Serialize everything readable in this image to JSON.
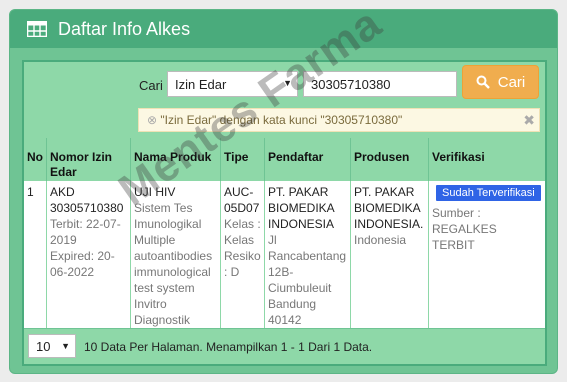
{
  "header": {
    "title": "Daftar Info Alkes",
    "icon": "table-icon"
  },
  "search": {
    "cari_label": "Cari",
    "select_value": "Izin Edar",
    "input_value": "30305710380",
    "button_label": "Cari",
    "alert_text": "\"Izin Edar\" dengan kata kunci \"30305710380\""
  },
  "table": {
    "headers": [
      "No",
      "Nomor Izin Edar",
      "Nama Produk",
      "Tipe",
      "Pendaftar",
      "Produsen",
      "Verifikasi"
    ],
    "rows": [
      {
        "no": "1",
        "nomor": "AKD 30305710380",
        "terbit": "Terbit: 22-07-2019",
        "expired": "Expired: 20-06-2022",
        "produk": "UJI HIV",
        "produk_desc": "Sistem Tes Imunologikal Multiple autoantibodies immunological test system Invitro Diagnostik",
        "tipe": "AUC-05D07",
        "kelas": "Kelas : Kelas Resiko : D",
        "pendaftar": "PT. PAKAR BIOMEDIKA INDONESIA",
        "pendaftar_alamat": "Jl Rancabentang 12B-Ciumbuleuit Bandung 40142",
        "produsen": "PT. PAKAR BIOMEDIKA INDONESIA.",
        "produsen_negara": "Indonesia",
        "verifikasi_badge": "Sudah Terverifikasi",
        "sumber": "Sumber : REGALKES TERBIT"
      }
    ]
  },
  "footer": {
    "per_page": "10",
    "info": "10 Data Per Halaman. Menampilkan 1 - 1 Dari 1 Data."
  },
  "watermark": "Mentes Farma",
  "colors": {
    "header": "#4aab7c",
    "panel": "#6fc494",
    "bar": "#8ed8a8",
    "button": "#f0ad4e",
    "badge": "#2f64e6"
  }
}
